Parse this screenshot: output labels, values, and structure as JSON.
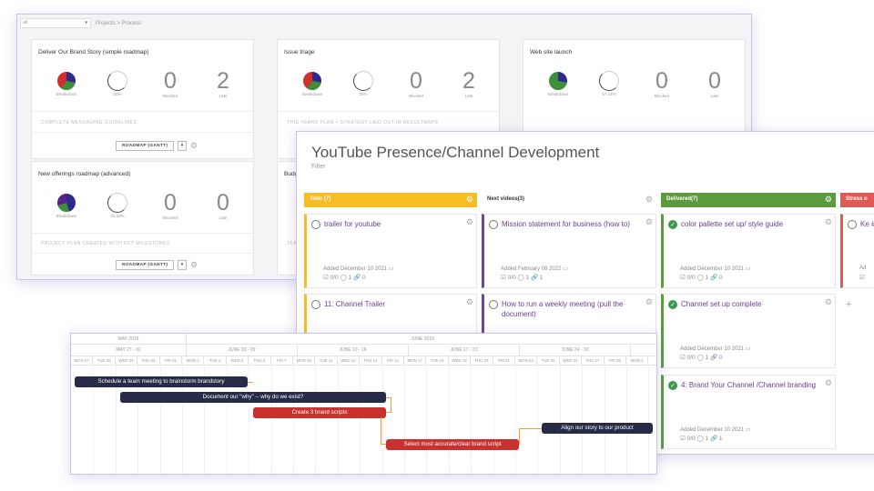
{
  "dashboard": {
    "selector": "all",
    "breadcrumb": "Projects > Process",
    "metric_labels": {
      "breakdown": "Breakdown",
      "blocked": "Blocked",
      "late": "Late"
    },
    "button": "ROADMAP (GANTT)",
    "cards": [
      {
        "title": "Deliver Our Brand Story (simple roadmap)",
        "percent": "50%",
        "blocked": "0",
        "late": "2",
        "subtitle": "COMPLETE MESSAGING GUIDELINES"
      },
      {
        "title": "Issue triage",
        "percent": "50%",
        "blocked": "0",
        "late": "2",
        "subtitle": "THIS YEARS PLAN + STRATEGY LAID OUT IN RESULTMAPS"
      },
      {
        "title": "Web site launch",
        "percent": "57.14%",
        "blocked": "0",
        "late": "0"
      },
      {
        "title": "New offerings roadmap (advanced)",
        "percent": "33.33%",
        "blocked": "0",
        "late": "0",
        "subtitle": "PROJECT PLAN CREATED WITH KEY MILESTONES"
      },
      {
        "title": "Budg"
      }
    ],
    "partial_text": "TEA"
  },
  "board": {
    "title": "YouTube Presence/Channel Development",
    "filter": "Filter",
    "columns": [
      {
        "name": "Todo (7)",
        "color": "#f7bd25"
      },
      {
        "name": "Next videos(3)",
        "color": "#ffffff"
      },
      {
        "name": "Delivered(7)",
        "color": "#5c9a3e"
      },
      {
        "name": "Stress o",
        "color": "#e05a55"
      }
    ],
    "tasks": [
      {
        "title": "trailer for youtube",
        "added": "Added December 10 2021",
        "stats": "☑ 0/0  ◯ 1  🔗 0"
      },
      {
        "title": "Mission statement for business (how to)",
        "added": "Added February 08 2022",
        "stats": "☑ 0/0  ◯ 1  🔗 1"
      },
      {
        "title": "color pallette set up/ style guide",
        "added": "Added December 10 2021",
        "stats": "☑ 0/0  ◯ 1  🔗 0"
      },
      {
        "title": "Ke #E",
        "added": "Ad",
        "stats": "☑"
      },
      {
        "title": "11: Channel Trailer"
      },
      {
        "title": "How to run a weekly meeting (pull the document)"
      },
      {
        "title": "Channel set up complete",
        "added": "Added December 10 2021",
        "stats": "☑ 0/0  ◯ 1  🔗 0"
      },
      {
        "title": "4: Brand Your Channel /Channel branding",
        "added": "Added December 10 2021",
        "stats": "☑ 0/0  ◯ 1  🔗 1"
      }
    ]
  },
  "gantt": {
    "months": [
      "MAY 2019",
      "JUNE 2019"
    ],
    "weeks": [
      "MAY 27 - 02",
      "JUNE 03 - 09",
      "JUNE 10 - 16",
      "JUNE 17 - 23",
      "JUNE 24 - 30"
    ],
    "days": [
      "MON 27",
      "TUE 28",
      "WED 29",
      "THU 30",
      "FRI 31",
      "MON 3",
      "TUE 4",
      "WED 5",
      "THU 6",
      "FRI 7",
      "MON 10",
      "TUE 11",
      "WED 12",
      "THU 13",
      "FRI 14",
      "MON 17",
      "TUE 18",
      "WED 19",
      "THU 20",
      "FRI 21",
      "MON 24",
      "TUE 25",
      "WED 26",
      "THU 27",
      "FRI 28",
      "MON 1"
    ],
    "bars": [
      "Schedule a team meeting to brainstorm brandstory",
      "Document our \"why\" -- why do we exist?",
      "Create 3 brand scripts",
      "Select most accurate/clear brand script",
      "Align our story to our product"
    ]
  }
}
